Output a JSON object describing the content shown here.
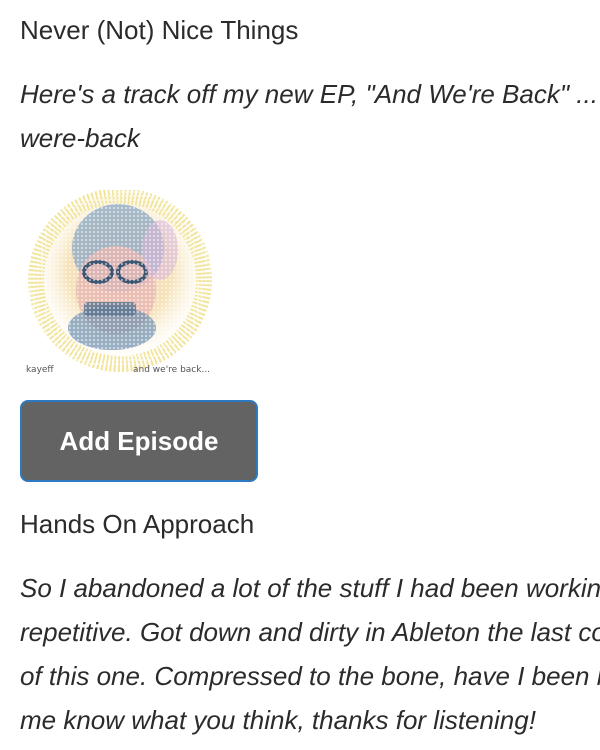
{
  "episodes": [
    {
      "title": "Never (Not) Nice Things",
      "description_lines": [
        "Here's a track off my new EP, \"And We're Back\" ... https://kayeff.bandcamp.com/album/and-were-back",
        "were-back"
      ],
      "artwork": {
        "artist_label": "kayeff",
        "album_label": "and we're back..."
      },
      "add_button_label": "Add Episode"
    },
    {
      "title": "Hands On Approach",
      "description_lines": [
        "So I abandoned a lot of the stuff I had been working on that was getting too",
        "repetitive. Got down and dirty in Ableton the last couple of weeks, the result",
        "of this one. Compressed to the bone, have I been listening to too much? Let",
        "me know what you think, thanks for listening!"
      ]
    }
  ]
}
